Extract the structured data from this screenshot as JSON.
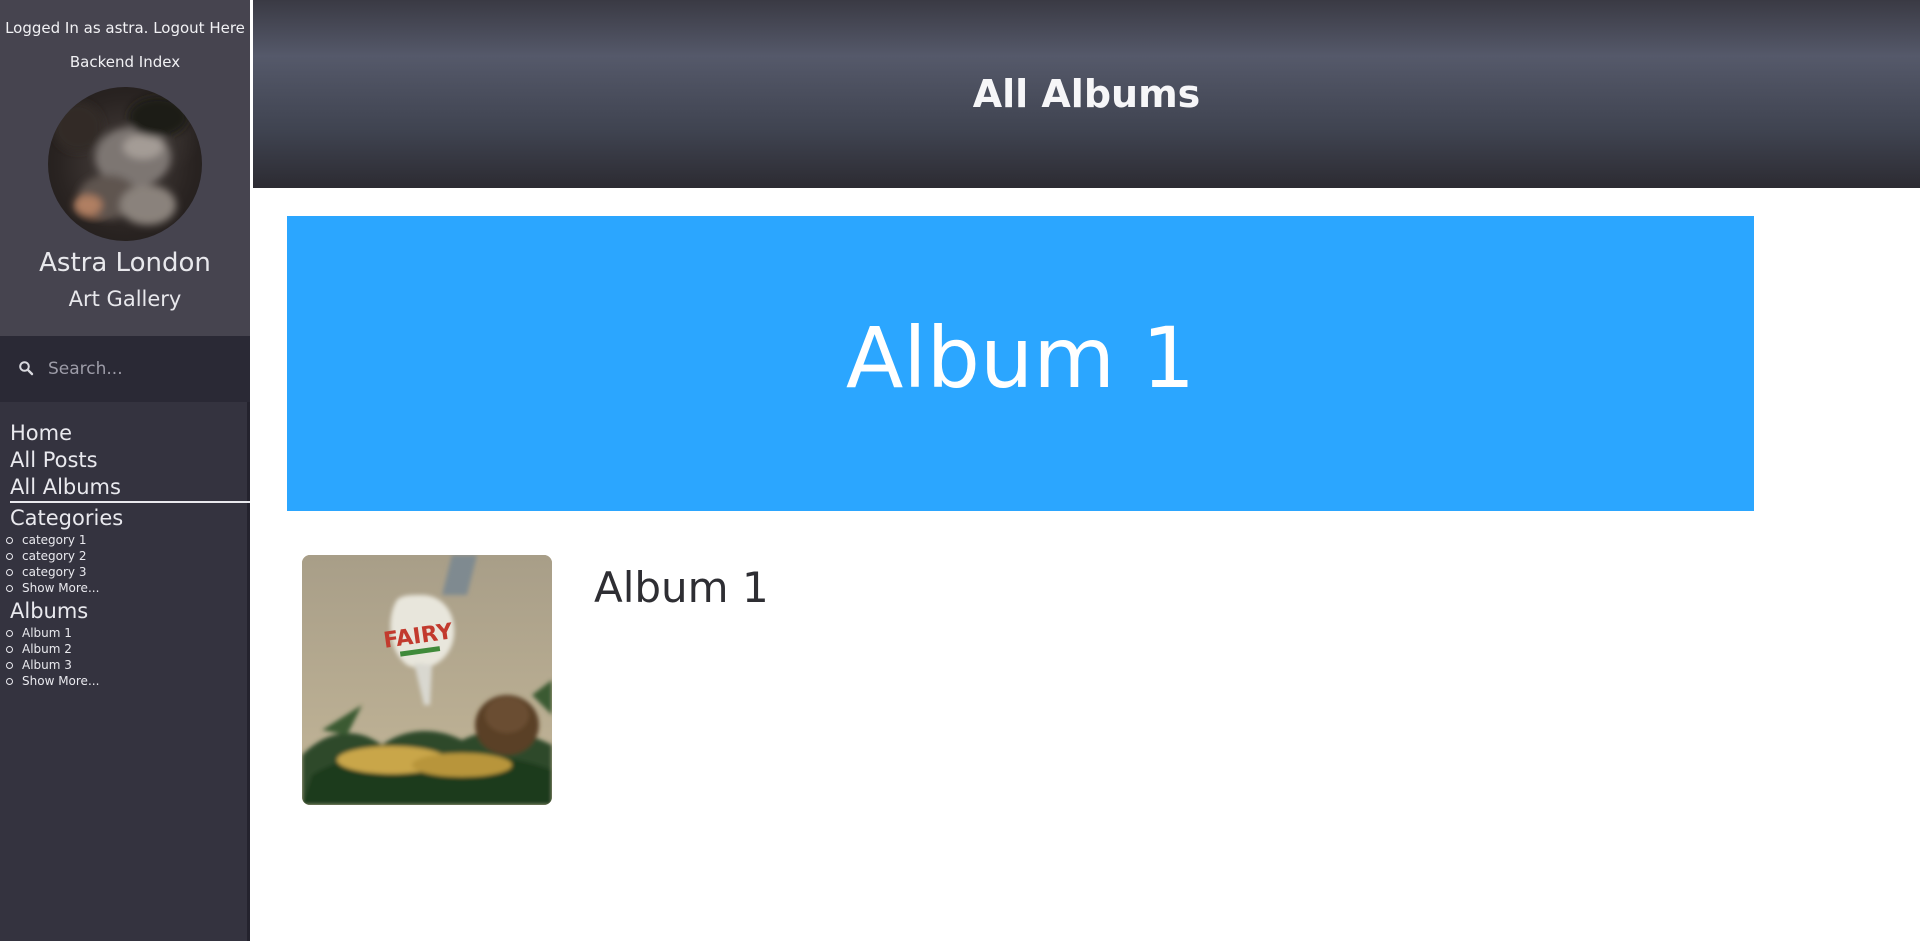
{
  "sidebar": {
    "login_text": "Logged In as astra.",
    "logout_label": "Logout Here",
    "backend_index_label": "Backend Index",
    "site_name": "Astra London",
    "site_subtitle": "Art Gallery",
    "search": {
      "placeholder": "Search..."
    },
    "nav": {
      "home": "Home",
      "all_posts": "All Posts",
      "all_albums": "All Albums",
      "categories_heading": "Categories",
      "categories": [
        "category 1",
        "category 2",
        "category 3",
        "Show More..."
      ],
      "albums_heading": "Albums",
      "albums": [
        "Album 1",
        "Album 2",
        "Album 3",
        "Show More..."
      ]
    }
  },
  "header": {
    "title": "All Albums"
  },
  "main": {
    "banner_title": "Album 1",
    "album": {
      "name": "Album 1",
      "thumbnail_text": "FAIRY"
    }
  },
  "colors": {
    "sidebar_bg": "#34333f",
    "sidebar_top_bg": "#46444f",
    "banner_bg": "#2ba6ff"
  }
}
